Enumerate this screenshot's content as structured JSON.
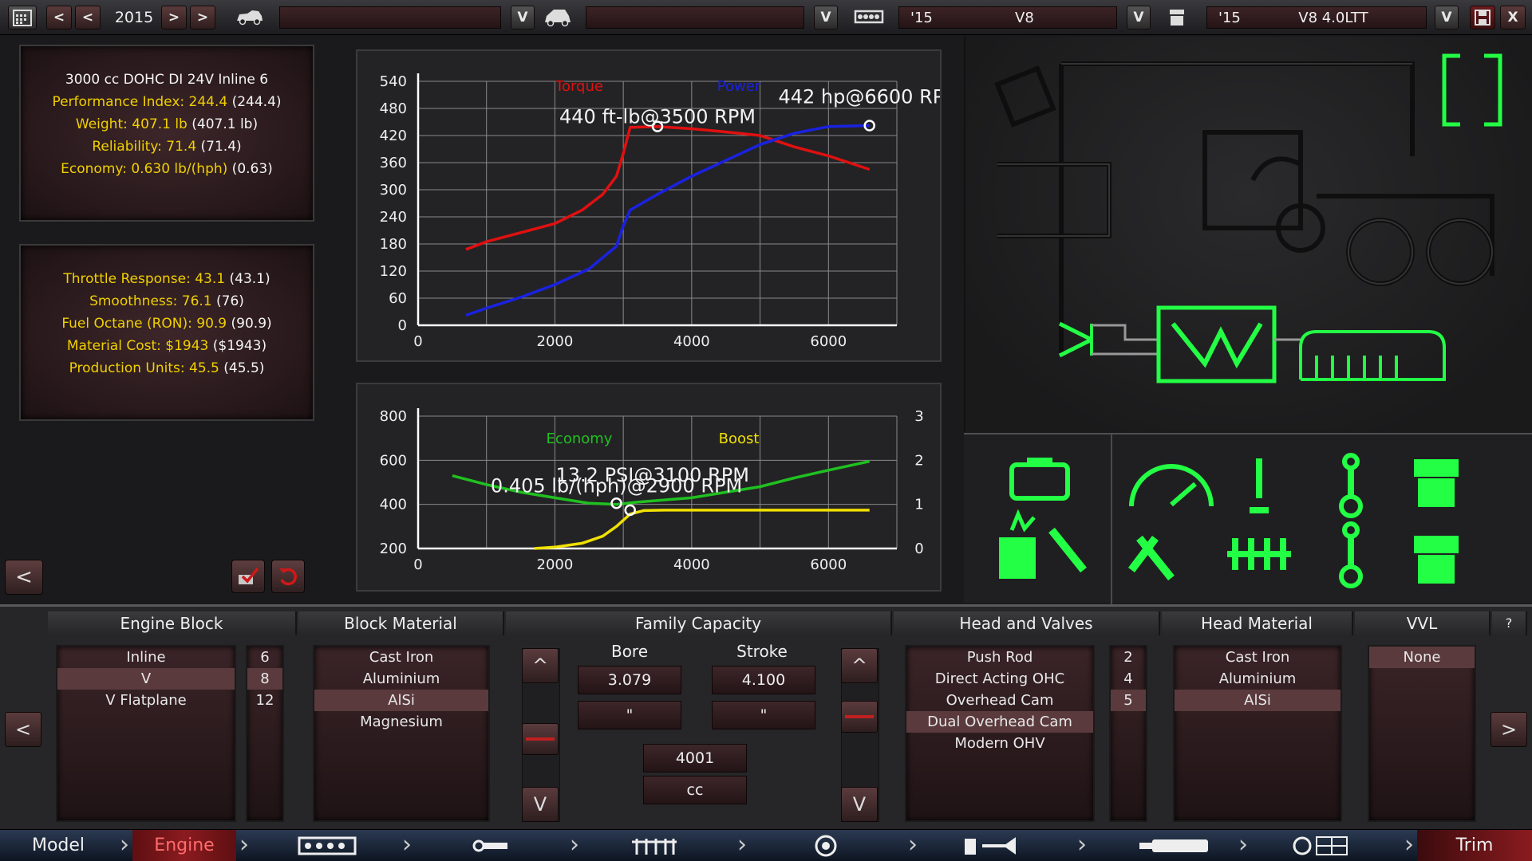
{
  "topbar": {
    "year": "2015",
    "prev_label": "<",
    "prev2_label": "<",
    "next_label": ">",
    "next2_label": ">",
    "dropdown_arrow": "V",
    "family_year": "'15",
    "family_name": "V8",
    "variant_year": "'15",
    "variant_name": "V8 4.0LTT",
    "close_label": "X"
  },
  "stats_top": {
    "title": "3000 cc DOHC DI 24V Inline 6",
    "lines": [
      {
        "label": "Performance Index: 244.4",
        "extra": " (244.4)"
      },
      {
        "label": "Weight: 407.1 lb",
        "extra": " (407.1 lb)"
      },
      {
        "label": "Reliability: 71.4",
        "extra": " (71.4)"
      },
      {
        "label": "Economy: 0.630 lb/(hph)",
        "extra": " (0.63)"
      }
    ]
  },
  "stats_bottom": {
    "lines": [
      {
        "label": "Throttle Response: 43.1",
        "extra": " (43.1)"
      },
      {
        "label": "Smoothness: 76.1",
        "extra": " (76)"
      },
      {
        "label": "Fuel Octane (RON): 90.9",
        "extra": " (90.9)"
      },
      {
        "label": "Material Cost: $1943",
        "extra": " ($1943)"
      },
      {
        "label": "Production Units: 45.5",
        "extra": " (45.5)"
      }
    ]
  },
  "left_buttons": {
    "back_label": "<"
  },
  "chart_data": [
    {
      "type": "line",
      "title": "",
      "xlim": [
        0,
        7000
      ],
      "ylim": [
        0,
        540
      ],
      "x_ticks": [
        "0",
        "2000",
        "4000",
        "6000"
      ],
      "y_ticks": [
        "0",
        "60",
        "120",
        "180",
        "240",
        "300",
        "360",
        "420",
        "480",
        "540"
      ],
      "series": [
        {
          "name": "Torque",
          "color": "#e01010",
          "x": [
            700,
            1000,
            1500,
            2000,
            2400,
            2700,
            2900,
            3000,
            3100,
            3500,
            4000,
            4500,
            5000,
            5500,
            6000,
            6600
          ],
          "y": [
            168,
            185,
            205,
            225,
            255,
            290,
            330,
            380,
            438,
            440,
            435,
            428,
            420,
            395,
            375,
            345
          ]
        },
        {
          "name": "Power",
          "color": "#1a22e0",
          "x": [
            700,
            1000,
            1500,
            2000,
            2500,
            2900,
            3000,
            3100,
            3500,
            4000,
            4500,
            5000,
            5500,
            6000,
            6600
          ],
          "y": [
            22,
            38,
            62,
            90,
            125,
            175,
            220,
            255,
            290,
            330,
            365,
            400,
            425,
            440,
            442
          ]
        }
      ],
      "annotations": [
        {
          "text": "440 ft-lb@3500 RPM",
          "x": 3500,
          "y": 440
        },
        {
          "text": "442 hp@6600 RPM",
          "x": 6600,
          "y": 442
        }
      ]
    },
    {
      "type": "line",
      "title": "",
      "xlim": [
        0,
        7000
      ],
      "ylim": [
        200,
        800
      ],
      "y2lim": [
        0,
        3
      ],
      "x_ticks": [
        "0",
        "2000",
        "4000",
        "6000"
      ],
      "y_ticks": [
        "200",
        "400",
        "600",
        "800"
      ],
      "y2_ticks": [
        "0",
        "1",
        "2",
        "3"
      ],
      "series": [
        {
          "name": "Economy",
          "color": "#20c020",
          "axis": "left",
          "x": [
            500,
            1000,
            1500,
            2000,
            2500,
            2900,
            3200,
            3600,
            4000,
            4500,
            5000,
            5500,
            6000,
            6600
          ],
          "y": [
            530,
            490,
            455,
            430,
            405,
            400,
            410,
            420,
            430,
            455,
            480,
            520,
            555,
            595
          ]
        },
        {
          "name": "Boost",
          "color": "#f0e000",
          "axis": "right",
          "x": [
            1700,
            2000,
            2400,
            2700,
            2900,
            3100,
            3300,
            3600,
            4000,
            5000,
            6000,
            6600
          ],
          "y": [
            0.0,
            0.03,
            0.12,
            0.28,
            0.5,
            0.78,
            0.86,
            0.87,
            0.87,
            0.87,
            0.87,
            0.87
          ]
        }
      ],
      "annotations": [
        {
          "text": "13.2 PSI@3100 RPM",
          "x": 3100,
          "y2": 0.87
        },
        {
          "text": "0.405 lb/(hph)@2900 RPM",
          "x": 2900,
          "y": 405
        }
      ]
    }
  ],
  "config": {
    "columns": {
      "engine_block": "Engine Block",
      "block_material": "Block Material",
      "family_capacity": "Family Capacity",
      "head_valves": "Head and Valves",
      "head_material": "Head Material",
      "vvl": "VVL",
      "help": "?"
    },
    "engine_block": {
      "items": [
        "Inline",
        "V",
        "V Flatplane"
      ],
      "counts": [
        "6",
        "8",
        "12"
      ],
      "selected": 1
    },
    "block_material": {
      "items": [
        "Cast Iron",
        "Aluminium",
        "AlSi",
        "Magnesium"
      ],
      "selected": 2
    },
    "capacity": {
      "bore_label": "Bore",
      "stroke_label": "Stroke",
      "bore_value": "3.079",
      "stroke_value": "4.100",
      "bore_unit": "\"",
      "stroke_unit": "\"",
      "displacement": "4001",
      "displacement_unit": "cc",
      "up_label": "^",
      "down_label": "V"
    },
    "head_valves": {
      "items": [
        "Push Rod",
        "Direct Acting OHC",
        "Overhead Cam",
        "Dual Overhead Cam",
        "Modern OHV"
      ],
      "counts": [
        "2",
        "4",
        "5"
      ],
      "selected": 3
    },
    "head_material": {
      "items": [
        "Cast Iron",
        "Aluminium",
        "AlSi"
      ],
      "selected": 2
    },
    "vvl": {
      "items": [
        "None"
      ],
      "selected": 0
    },
    "nav_left": "<",
    "nav_right": ">"
  },
  "nav": {
    "model": "Model",
    "engine": "Engine",
    "trim": "Trim"
  }
}
